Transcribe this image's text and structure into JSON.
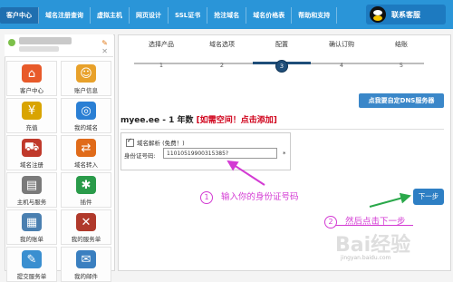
{
  "nav": {
    "items": [
      "客户中心",
      "域名注册查询",
      "虚拟主机",
      "网页设计",
      "SSL证书",
      "抢注域名",
      "域名价格表",
      "帮助和支持"
    ],
    "customer_service": "联系客服"
  },
  "sidebar": {
    "tiles": [
      {
        "label": "客户中心",
        "icon": "house-icon",
        "color": "#e85a2a",
        "glyph": "⌂"
      },
      {
        "label": "账户信息",
        "icon": "user-icon",
        "color": "#e8a12a",
        "glyph": "☺"
      },
      {
        "label": "充值",
        "icon": "coins-icon",
        "color": "#d9a400",
        "glyph": "¥"
      },
      {
        "label": "我的域名",
        "icon": "globe-icon",
        "color": "#2a7fd4",
        "glyph": "◎"
      },
      {
        "label": "域名注册",
        "icon": "cart-icon",
        "color": "#c0392b",
        "glyph": "⛟"
      },
      {
        "label": "域名转入",
        "icon": "transfer-icon",
        "color": "#e06b1a",
        "glyph": "⇄"
      },
      {
        "label": "主机与服务",
        "icon": "server-icon",
        "color": "#7a7a7a",
        "glyph": "▤"
      },
      {
        "label": "插件",
        "icon": "plugin-icon",
        "color": "#2a9b4a",
        "glyph": "✱"
      },
      {
        "label": "我的账单",
        "icon": "invoice-icon",
        "color": "#4a7fb0",
        "glyph": "▦"
      },
      {
        "label": "我的服务单",
        "icon": "tools-icon",
        "color": "#b0392b",
        "glyph": "✕"
      },
      {
        "label": "提交服务单",
        "icon": "ticket-icon",
        "color": "#3a8fd0",
        "glyph": "✎"
      },
      {
        "label": "我的邮件",
        "icon": "mail-icon",
        "color": "#3a7fc0",
        "glyph": "✉"
      }
    ]
  },
  "steps": [
    {
      "name": "选择产品",
      "num": "1"
    },
    {
      "name": "域名选项",
      "num": "2"
    },
    {
      "name": "配置",
      "num": "3"
    },
    {
      "name": "确认订购",
      "num": "4"
    },
    {
      "name": "结账",
      "num": "5"
    }
  ],
  "main": {
    "dns_button": "点我要自定DNS服务器",
    "domain_title": "myee.ee - 1 年数",
    "domain_free": "[如需空间！点击添加]",
    "dns_check_label": "域名解析 (免费！)",
    "id_label": "身份证号码:",
    "id_value": "11010519900315385?",
    "required_mark": "*",
    "next_button": "下一步"
  },
  "annotations": {
    "note1_num": "1",
    "note1_text": "输入你的身份证号码",
    "note2_num": "2",
    "note2_text": "然后点击下一步",
    "watermark": "Bai经验",
    "watermark_sub": "jingyan.baidu.com"
  }
}
